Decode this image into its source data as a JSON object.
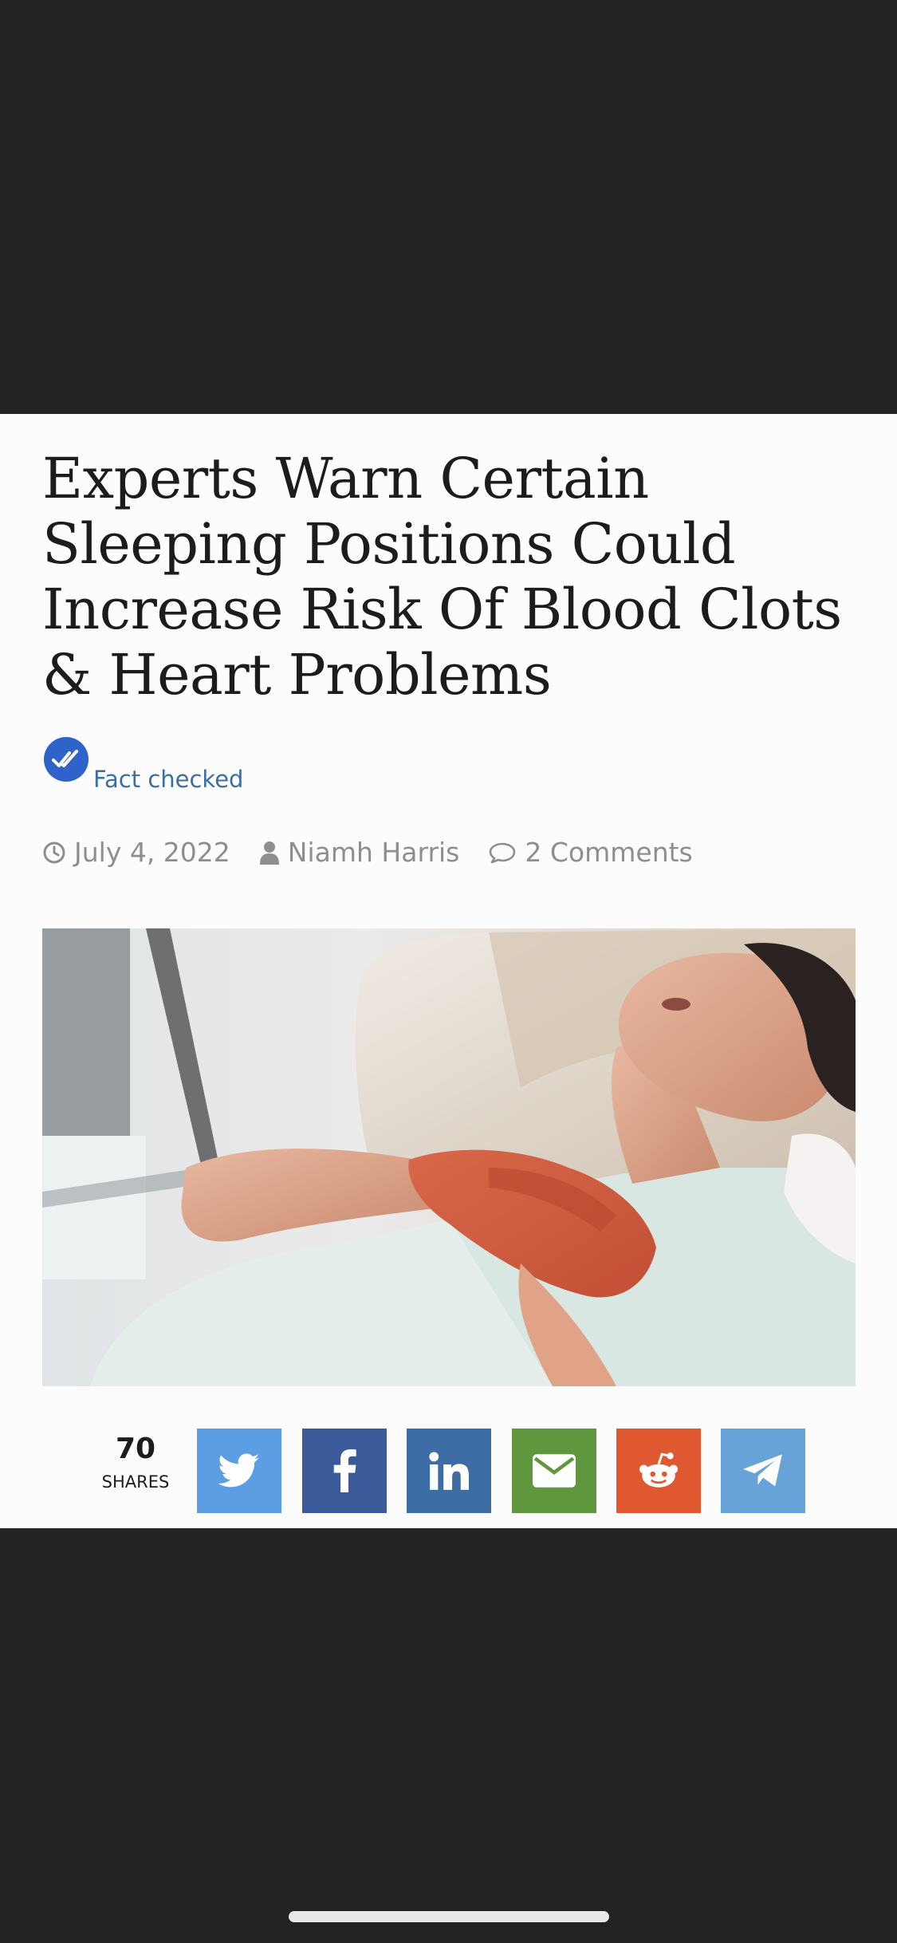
{
  "article": {
    "title": "Experts Warn Certain Sleeping Positions Could Increase Risk Of Blood Clots & Heart Problems",
    "fact_checked_label": "Fact checked",
    "date": "July 4, 2022",
    "author": "Niamh Harris",
    "comments": "2 Comments"
  },
  "share_bar": {
    "count": "70",
    "count_label": "SHARES",
    "buttons": [
      {
        "icon": "twitter-icon",
        "color": "#5c9ee4"
      },
      {
        "icon": "facebook-icon",
        "color": "#3b5a9a"
      },
      {
        "icon": "linkedin-icon",
        "color": "#3d6da5"
      },
      {
        "icon": "email-icon",
        "color": "#5f973e"
      },
      {
        "icon": "reddit-icon",
        "color": "#e0582f"
      },
      {
        "icon": "telegram-icon",
        "color": "#67a2d9"
      }
    ]
  },
  "colors": {
    "page_background": "#222323",
    "card_background": "#fcfcfc",
    "fact_check_blue": "#2f63c9"
  }
}
